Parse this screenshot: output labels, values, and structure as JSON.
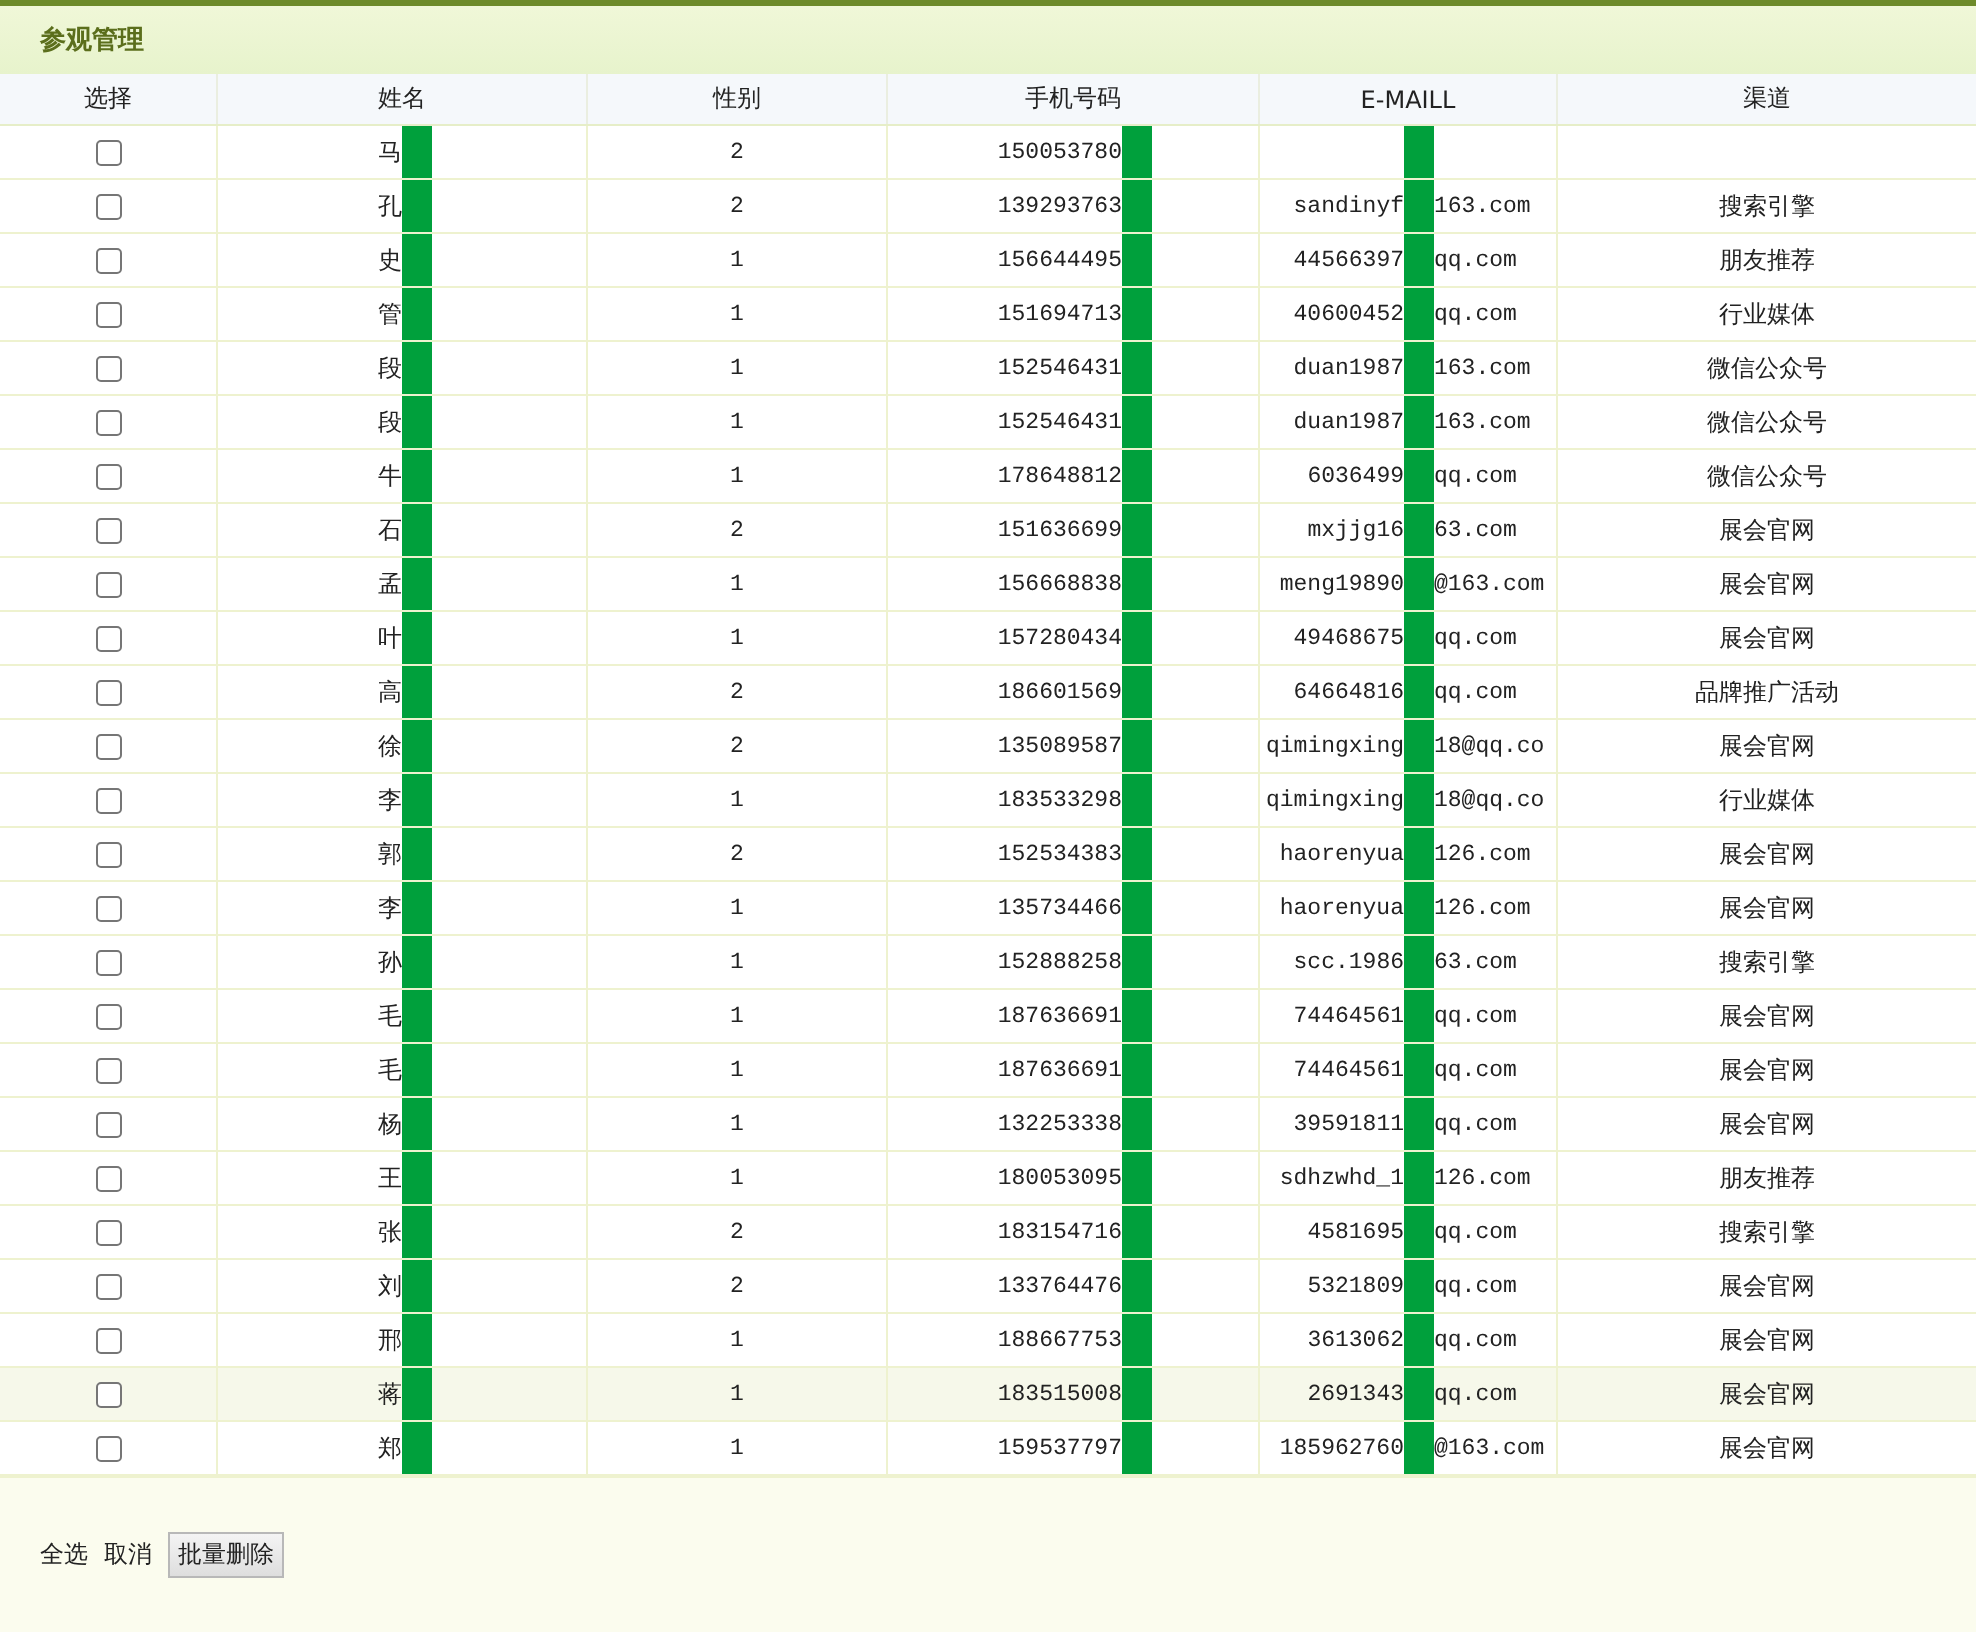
{
  "panel": {
    "title": "参观管理"
  },
  "table": {
    "columns": [
      "选择",
      "姓名",
      "性别",
      "手机号码",
      "E-MAILL",
      "渠道"
    ],
    "rows": [
      {
        "checked": false,
        "highlighted": false,
        "name": "马",
        "gender": "2",
        "phone": "150053780",
        "email_before": "",
        "email_after": "",
        "channel": ""
      },
      {
        "checked": false,
        "highlighted": false,
        "name": "孔",
        "gender": "2",
        "phone": "139293763",
        "email_before": "sandinyf",
        "email_after": "163.com",
        "channel": "搜索引擎"
      },
      {
        "checked": false,
        "highlighted": false,
        "name": "史",
        "gender": "1",
        "phone": "156644495",
        "email_before": "44566397",
        "email_after": "qq.com",
        "channel": "朋友推荐"
      },
      {
        "checked": false,
        "highlighted": false,
        "name": "管",
        "gender": "1",
        "phone": "151694713",
        "email_before": "40600452",
        "email_after": "qq.com",
        "channel": "行业媒体"
      },
      {
        "checked": false,
        "highlighted": false,
        "name": "段",
        "gender": "1",
        "phone": "152546431",
        "email_before": "duan1987",
        "email_after": "163.com",
        "channel": "微信公众号"
      },
      {
        "checked": false,
        "highlighted": false,
        "name": "段",
        "gender": "1",
        "phone": "152546431",
        "email_before": "duan1987",
        "email_after": "163.com",
        "channel": "微信公众号"
      },
      {
        "checked": false,
        "highlighted": false,
        "name": "牛",
        "gender": "1",
        "phone": "178648812",
        "email_before": "6036499",
        "email_after": "qq.com",
        "channel": "微信公众号"
      },
      {
        "checked": false,
        "highlighted": false,
        "name": "石",
        "gender": "2",
        "phone": "151636699",
        "email_before": "mxjjg16",
        "email_after": "63.com",
        "channel": "展会官网"
      },
      {
        "checked": false,
        "highlighted": false,
        "name": "孟",
        "gender": "1",
        "phone": "156668838",
        "email_before": "meng19890",
        "email_after": "@163.com",
        "channel": "展会官网"
      },
      {
        "checked": false,
        "highlighted": false,
        "name": "叶",
        "gender": "1",
        "phone": "157280434",
        "email_before": "49468675",
        "email_after": "qq.com",
        "channel": "展会官网"
      },
      {
        "checked": false,
        "highlighted": false,
        "name": "高",
        "gender": "2",
        "phone": "186601569",
        "email_before": "64664816",
        "email_after": "qq.com",
        "channel": "品牌推广活动"
      },
      {
        "checked": false,
        "highlighted": false,
        "name": "徐",
        "gender": "2",
        "phone": "135089587",
        "email_before": "qimingxing",
        "email_after": "18@qq.co",
        "channel": "展会官网"
      },
      {
        "checked": false,
        "highlighted": false,
        "name": "李",
        "gender": "1",
        "phone": "183533298",
        "email_before": "qimingxing",
        "email_after": "18@qq.co",
        "channel": "行业媒体"
      },
      {
        "checked": false,
        "highlighted": false,
        "name": "郭",
        "gender": "2",
        "phone": "152534383",
        "email_before": "haorenyua",
        "email_after": "126.com",
        "channel": "展会官网"
      },
      {
        "checked": false,
        "highlighted": false,
        "name": "李",
        "gender": "1",
        "phone": "135734466",
        "email_before": "haorenyua",
        "email_after": "126.com",
        "channel": "展会官网"
      },
      {
        "checked": false,
        "highlighted": false,
        "name": "孙",
        "gender": "1",
        "phone": "152888258",
        "email_before": "scc.1986",
        "email_after": "63.com",
        "channel": "搜索引擎"
      },
      {
        "checked": false,
        "highlighted": false,
        "name": "毛",
        "gender": "1",
        "phone": "187636691",
        "email_before": "74464561",
        "email_after": "qq.com",
        "channel": "展会官网"
      },
      {
        "checked": false,
        "highlighted": false,
        "name": "毛",
        "gender": "1",
        "phone": "187636691",
        "email_before": "74464561",
        "email_after": "qq.com",
        "channel": "展会官网"
      },
      {
        "checked": false,
        "highlighted": false,
        "name": "杨",
        "gender": "1",
        "phone": "132253338",
        "email_before": "39591811",
        "email_after": "qq.com",
        "channel": "展会官网"
      },
      {
        "checked": false,
        "highlighted": false,
        "name": "王",
        "gender": "1",
        "phone": "180053095",
        "email_before": "sdhzwhd_1",
        "email_after": "126.com",
        "channel": "朋友推荐"
      },
      {
        "checked": false,
        "highlighted": false,
        "name": "张",
        "gender": "2",
        "phone": "183154716",
        "email_before": "4581695",
        "email_after": "qq.com",
        "channel": "搜索引擎"
      },
      {
        "checked": false,
        "highlighted": false,
        "name": "刘",
        "gender": "2",
        "phone": "133764476",
        "email_before": "5321809",
        "email_after": "qq.com",
        "channel": "展会官网"
      },
      {
        "checked": false,
        "highlighted": false,
        "name": "邢",
        "gender": "1",
        "phone": "188667753",
        "email_before": "3613062",
        "email_after": "qq.com",
        "channel": "展会官网"
      },
      {
        "checked": false,
        "highlighted": true,
        "name": "蒋",
        "gender": "1",
        "phone": "183515008",
        "email_before": "2691343",
        "email_after": "qq.com",
        "channel": "展会官网"
      },
      {
        "checked": false,
        "highlighted": false,
        "name": "郑",
        "gender": "1",
        "phone": "159537797",
        "email_before": "185962760",
        "email_after": "@163.com",
        "channel": "展会官网"
      }
    ]
  },
  "footer": {
    "select_all": "全选",
    "cancel": "取消",
    "batch_delete": "批量删除"
  }
}
